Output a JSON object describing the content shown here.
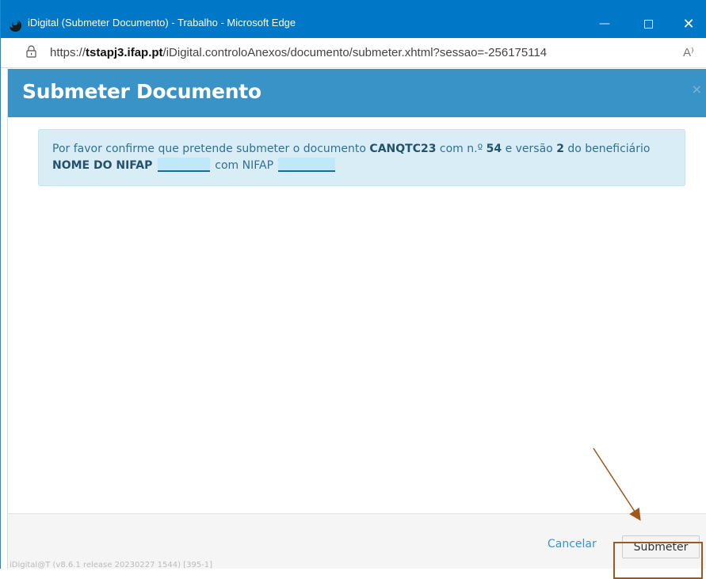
{
  "window": {
    "title": "iDigital (Submeter Documento) - Trabalho - Microsoft Edge"
  },
  "addressbar": {
    "url_prefix": "https://",
    "url_host": "tstapj3.ifap.pt",
    "url_path": "/iDigital.controloAnexos/documento/submeter.xhtml?sessao=-256175114",
    "read_aloud_glyph": "A⁾"
  },
  "dialog": {
    "title": "Submeter Documento",
    "close_glyph": "×",
    "message": {
      "part1": "Por favor confirme que pretende submeter o documento ",
      "doc_code": "CANQTC23",
      "part2": " com n.º ",
      "number": "54",
      "part3": " e versão ",
      "version": "2",
      "part4": " do beneficiário ",
      "beneficiary": "NOME DO NIFAP",
      "part5": " com NIFAP "
    }
  },
  "footer": {
    "cancel_label": "Cancelar",
    "submit_label": "Submeter",
    "version_text": "iDigital@T (v8.6.1 release 20230227 1544) [395-1]"
  },
  "annotation": {
    "color": "#a0571e"
  },
  "icons": {
    "lock": "lock-icon",
    "logo": "edge-logo-icon",
    "minimize": "minimize-icon",
    "maximize": "maximize-icon",
    "close": "close-icon"
  }
}
